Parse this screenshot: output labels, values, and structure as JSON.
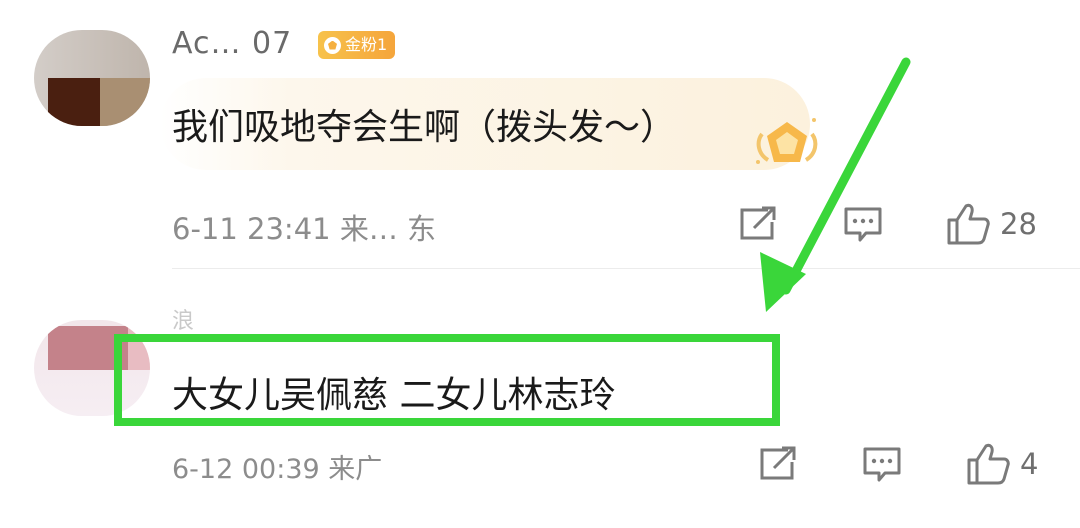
{
  "comments": [
    {
      "username": "Ac… 07",
      "fan_badge": "金粉1",
      "text": "我们吸地夺会生啊（拨头发～）",
      "time": "6-11 23:41",
      "location": "来… 东",
      "like_count": "28"
    },
    {
      "username": "浪",
      "text": "大女儿吴佩慈  二女儿林志玲",
      "time": "6-12 00:39",
      "location": "来广",
      "like_count": "4"
    }
  ],
  "annotation": {
    "highlight_color": "#3ad63a"
  },
  "icons": {
    "share": "share-icon",
    "comment": "comment-icon",
    "like": "like-icon",
    "badge": "medal-icon"
  }
}
